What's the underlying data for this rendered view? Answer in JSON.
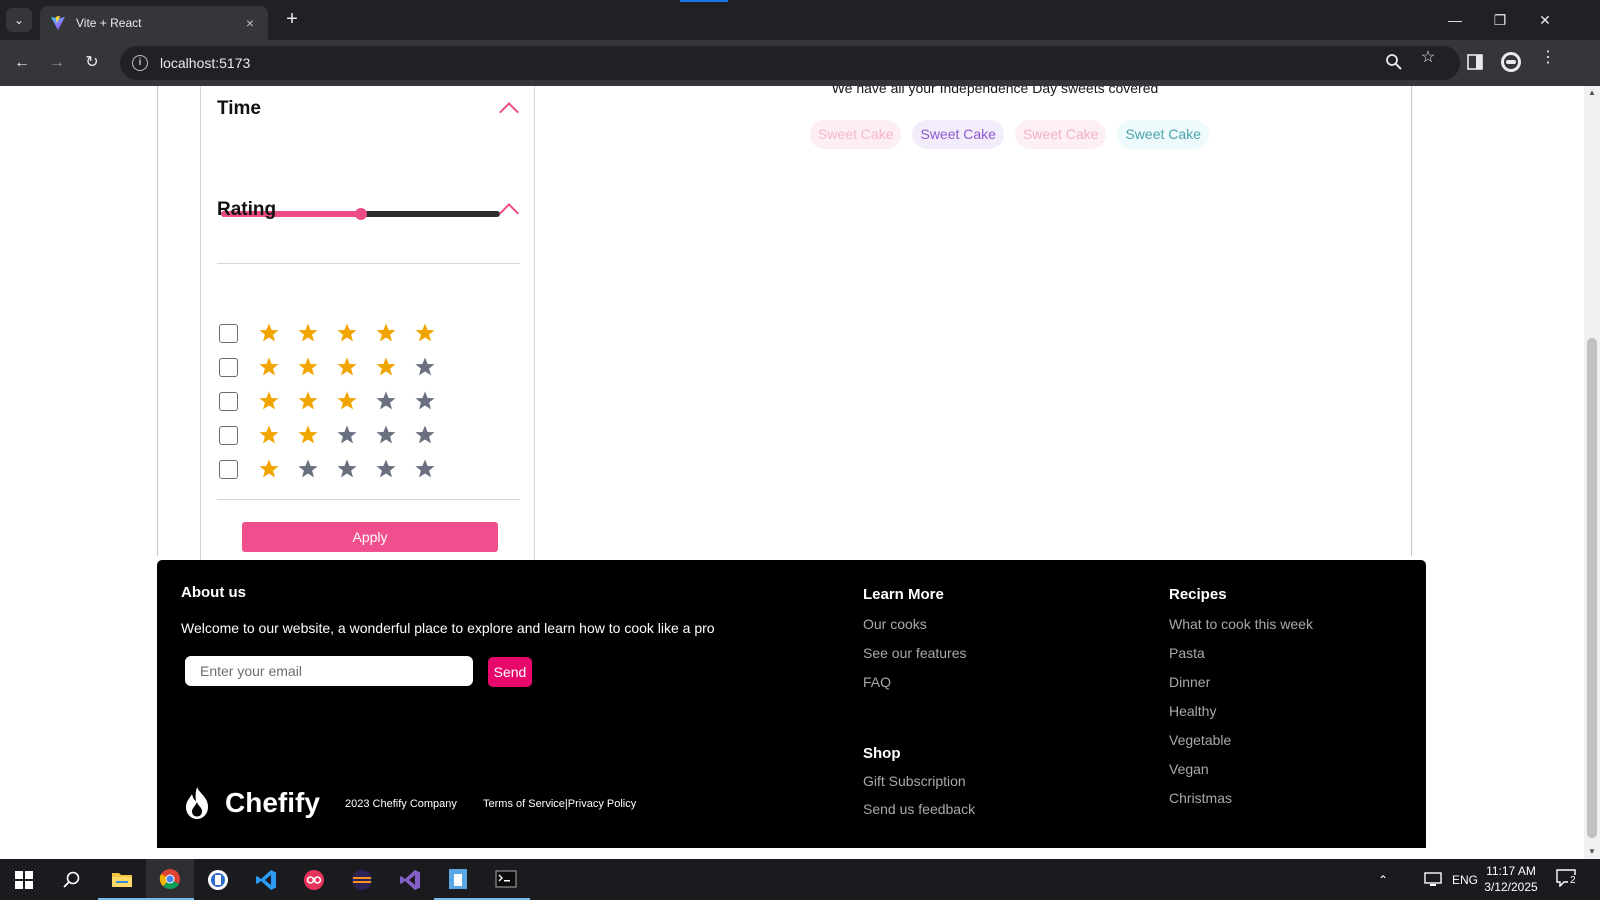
{
  "browser": {
    "tab_title": "Vite + React",
    "url": "localhost:5173",
    "new_tab_symbol": "+",
    "close_symbol": "×"
  },
  "filters": {
    "time": {
      "title": "Time",
      "slider_value_fraction": 0.5
    },
    "rating": {
      "title": "Rating",
      "max_stars": 5,
      "rows": [
        5,
        4,
        3,
        2,
        1
      ]
    },
    "apply_label": "Apply"
  },
  "content": {
    "subtitle": "We have all your Independence Day sweets covered",
    "chips": [
      {
        "label": "Sweet Cake",
        "bg": "#fdeef3",
        "color": "#f4b6cc"
      },
      {
        "label": "Sweet Cake",
        "bg": "#f3edfb",
        "color": "#8c5bd0"
      },
      {
        "label": "Sweet Cake",
        "bg": "#fdf0f3",
        "color": "#f1b2c4"
      },
      {
        "label": "Sweet Cake",
        "bg": "#eefafb",
        "color": "#4aa3ad"
      }
    ]
  },
  "footer": {
    "about_title": "About us",
    "about_text": "Welcome to our website, a wonderful place to explore and learn how to cook like a pro",
    "email_placeholder": "Enter your email",
    "send_label": "Send",
    "brand_name": "Chefify",
    "copyright": "2023 Chefify Company",
    "terms": "Terms of Service",
    "separator": "|",
    "privacy": "Privacy Policy",
    "learn_more": {
      "title": "Learn More",
      "links": [
        "Our cooks",
        "See our features",
        "FAQ"
      ]
    },
    "shop": {
      "title": "Shop",
      "links": [
        "Gift Subscription",
        "Send us feedback"
      ]
    },
    "recipes": {
      "title": "Recipes",
      "links": [
        "What to cook this week",
        "Pasta",
        "Dinner",
        "Healthy",
        "Vegetable",
        "Vegan",
        "Christmas"
      ]
    }
  },
  "taskbar": {
    "language": "ENG",
    "time": "11:17 AM",
    "date": "3/12/2025",
    "notification_count": "2"
  },
  "colors": {
    "accent_pink": "#ec4c86",
    "star_filled": "#f0a500",
    "star_empty": "#6b7081",
    "send_button": "#e8086b"
  }
}
